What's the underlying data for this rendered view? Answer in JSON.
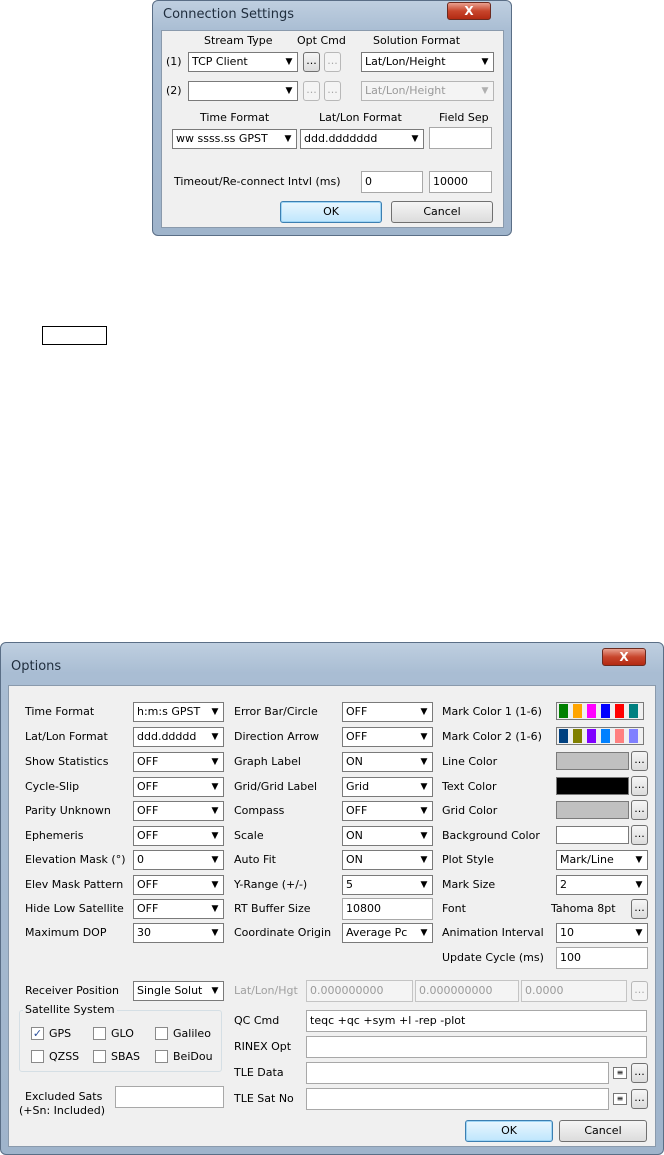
{
  "conn": {
    "title": "Connection Settings",
    "close": "X",
    "headers": {
      "stream_type": "Stream Type",
      "opt_cmd": "Opt Cmd",
      "solution_format": "Solution Format"
    },
    "rows": [
      {
        "num": "(1)",
        "stream": "TCP Client",
        "format": "Lat/Lon/Height"
      },
      {
        "num": "(2)",
        "stream": "",
        "format": "Lat/Lon/Height"
      }
    ],
    "dots": "...",
    "time_format_label": "Time Format",
    "latlon_format_label": "Lat/Lon Format",
    "field_sep_label": "Field Sep",
    "time_format": "ww ssss.ss GPST",
    "latlon_format": "ddd.ddddddd",
    "field_sep": "",
    "timeout_label": "Timeout/Re-connect Intvl (ms)",
    "timeout": "0",
    "reconnect": "10000",
    "ok": "OK",
    "cancel": "Cancel"
  },
  "opt": {
    "title": "Options",
    "close": "X",
    "dots": "...",
    "col1": [
      {
        "label": "Time Format",
        "value": "h:m:s GPST"
      },
      {
        "label": "Lat/Lon Format",
        "value": "ddd.ddddd"
      },
      {
        "label": "Show Statistics",
        "value": "OFF"
      },
      {
        "label": "Cycle-Slip",
        "value": "OFF"
      },
      {
        "label": "Parity Unknown",
        "value": "OFF"
      },
      {
        "label": "Ephemeris",
        "value": "OFF"
      },
      {
        "label": "Elevation Mask (°)",
        "value": "0"
      },
      {
        "label": "Elev Mask Pattern",
        "value": "OFF"
      },
      {
        "label": "Hide Low Satellite",
        "value": "OFF"
      },
      {
        "label": "Maximum DOP",
        "value": "30"
      }
    ],
    "col2": [
      {
        "label": "Error Bar/Circle",
        "value": "OFF"
      },
      {
        "label": "Direction Arrow",
        "value": "OFF"
      },
      {
        "label": "Graph Label",
        "value": "ON"
      },
      {
        "label": "Grid/Grid Label",
        "value": "Grid"
      },
      {
        "label": "Compass",
        "value": "OFF"
      },
      {
        "label": "Scale",
        "value": "ON"
      },
      {
        "label": "Auto Fit",
        "value": "ON"
      },
      {
        "label": "Y-Range (+/-)",
        "value": "5"
      },
      {
        "label": "RT Buffer Size",
        "value": "10800"
      },
      {
        "label": "Coordinate Origin",
        "value": "Average Pc"
      }
    ],
    "col3_labels": {
      "mark1": "Mark Color 1 (1-6)",
      "mark2": "Mark Color 2 (1-6)",
      "line": "Line Color",
      "text": "Text Color",
      "grid": "Grid Color",
      "bg": "Background Color",
      "plot_style": "Plot Style",
      "mark_size": "Mark Size",
      "font": "Font",
      "anim": "Animation Interval",
      "update": "Update Cycle (ms)"
    },
    "plot_style": "Mark/Line",
    "mark_size": "2",
    "font_value": "Tahoma 8pt",
    "anim_value": "10",
    "update_value": "100",
    "colors": {
      "mark1": [
        "#008000",
        "#ffa500",
        "#ff00ff",
        "#0000ff",
        "#ff0000",
        "#008080"
      ],
      "mark2": [
        "#004080",
        "#808000",
        "#8000ff",
        "#0080ff",
        "#ff8080",
        "#8080ff"
      ],
      "line": "#c0c0c0",
      "text": "#000000",
      "grid": "#c0c0c0",
      "bg": "#ffffff"
    },
    "receiver_position_label": "Receiver Position",
    "receiver_position": "Single Solut",
    "latlonhgt_label": "Lat/Lon/Hgt",
    "lat": "0.000000000",
    "lon": "0.000000000",
    "hgt": "0.0000",
    "satsys_label": "Satellite System",
    "sats": [
      {
        "label": "GPS",
        "checked": true
      },
      {
        "label": "GLO",
        "checked": false
      },
      {
        "label": "Galileo",
        "checked": false
      },
      {
        "label": "QZSS",
        "checked": false
      },
      {
        "label": "SBAS",
        "checked": false
      },
      {
        "label": "BeiDou",
        "checked": false
      }
    ],
    "check_mark": "✓",
    "excluded_label": "Excluded Sats",
    "excluded_note": "(+Sn: Included)",
    "excluded_value": "",
    "qc_cmd_label": "QC Cmd",
    "qc_cmd": "teqc +qc +sym +l -rep -plot",
    "rinex_opt_label": "RINEX Opt",
    "rinex_opt": "",
    "tle_data_label": "TLE Data",
    "tle_data": "",
    "tle_satno_label": "TLE Sat No",
    "tle_satno": "",
    "ok": "OK",
    "cancel": "Cancel"
  },
  "icons": {
    "dropdown_arrow": "▼"
  }
}
